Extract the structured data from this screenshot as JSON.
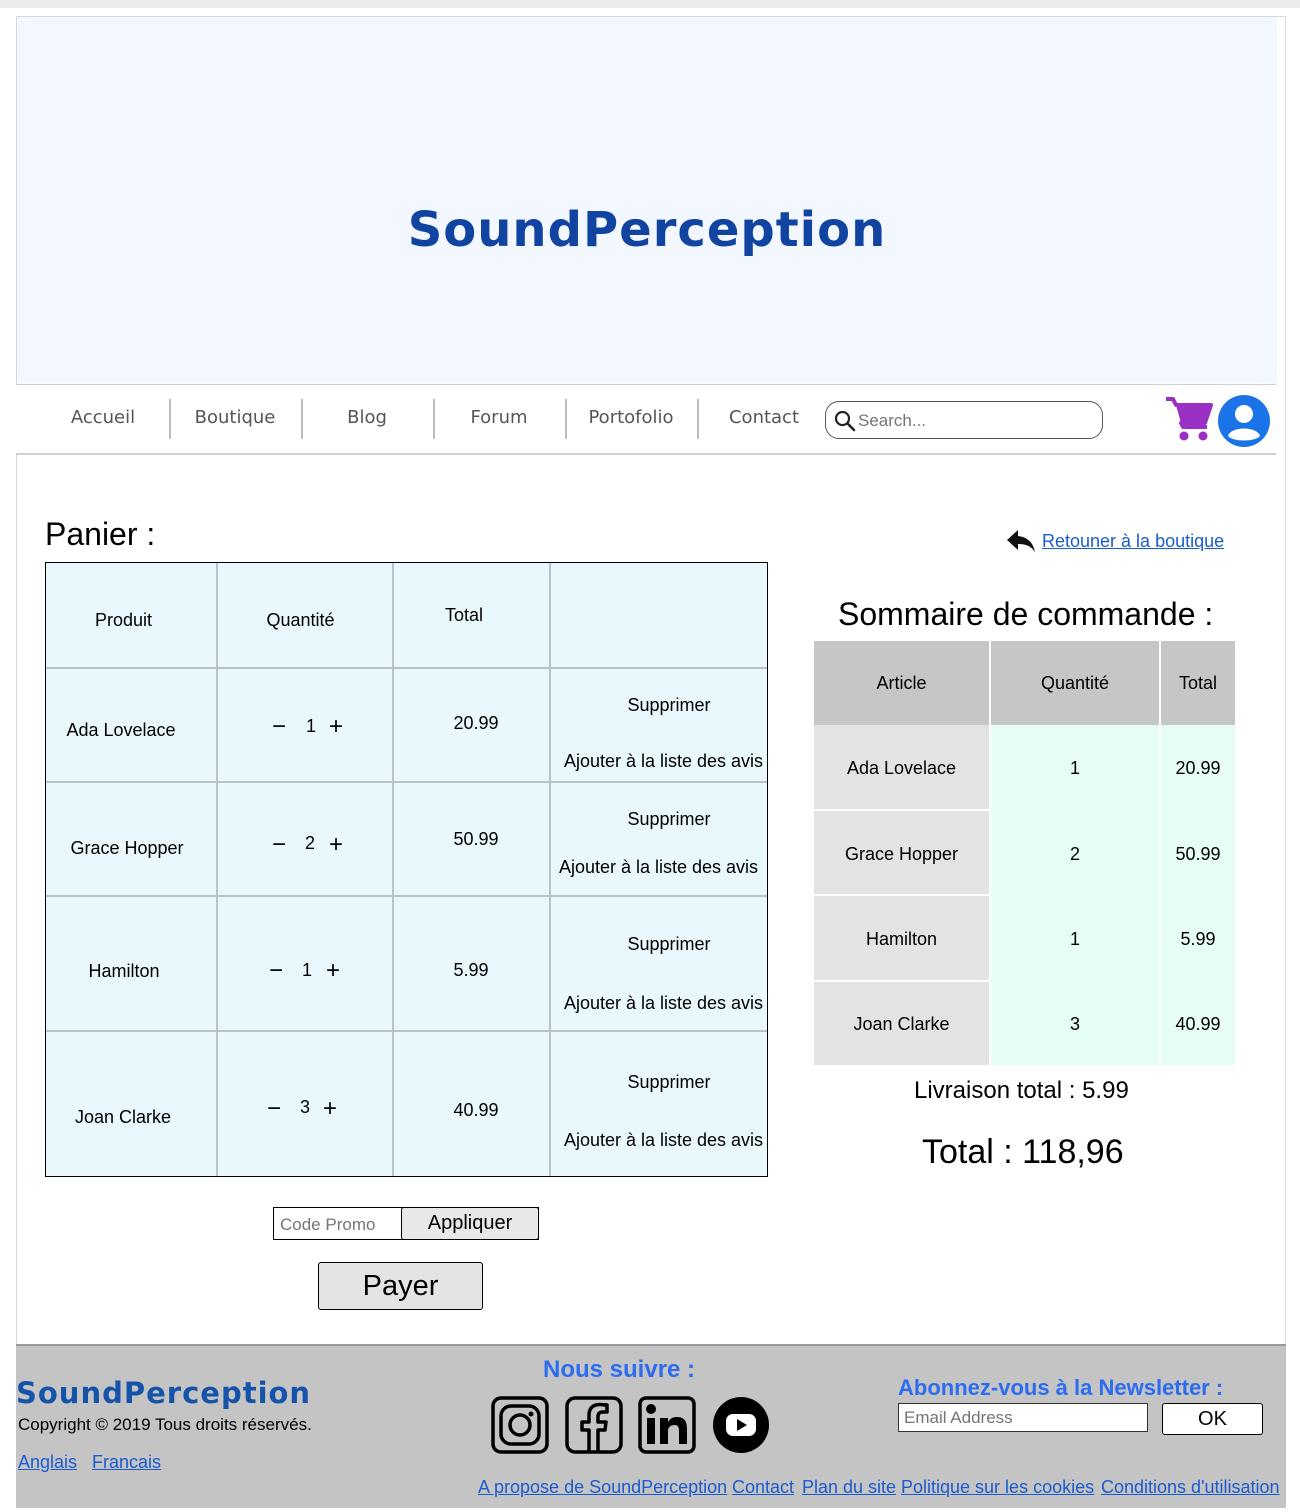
{
  "brand": "SoundPerception",
  "nav": {
    "items": [
      "Accueil",
      "Boutique",
      "Blog",
      "Forum",
      "Portofolio",
      "Contact"
    ],
    "search_placeholder": "Search..."
  },
  "cart": {
    "title": "Panier :",
    "back_link": "Retouner à la boutique",
    "headers": [
      "Produit",
      "Quantité",
      "Total",
      ""
    ],
    "rows": [
      {
        "product": "Ada Lovelace",
        "qty": "1",
        "total": "20.99",
        "remove": "Supprimer",
        "review": "Ajouter à la liste des avis"
      },
      {
        "product": "Grace Hopper",
        "qty": "2",
        "total": "50.99",
        "remove": "Supprimer",
        "review": "Ajouter à la liste des avis"
      },
      {
        "product": "Hamilton",
        "qty": "1",
        "total": "5.99",
        "remove": "Supprimer",
        "review": "Ajouter à la liste des avis"
      },
      {
        "product": "Joan Clarke",
        "qty": "3",
        "total": "40.99",
        "remove": "Supprimer",
        "review": "Ajouter à la liste des avis"
      }
    ],
    "minus": "−",
    "plus": "+"
  },
  "summary": {
    "title": "Sommaire de commande :",
    "headers": [
      "Article",
      "Quantité",
      "Total"
    ],
    "rows": [
      {
        "article": "Ada Lovelace",
        "qty": "1",
        "total": "20.99"
      },
      {
        "article": "Grace Hopper",
        "qty": "2",
        "total": "50.99"
      },
      {
        "article": "Hamilton",
        "qty": "1",
        "total": "5.99"
      },
      {
        "article": "Joan Clarke",
        "qty": "3",
        "total": "40.99"
      }
    ],
    "shipping": "Livraison total : 5.99",
    "total": "Total : 118,96"
  },
  "promo": {
    "placeholder": "Code Promo",
    "apply_label": "Appliquer"
  },
  "pay_label": "Payer",
  "footer": {
    "brand": "SoundPerception",
    "copyright": "Copyright © 2019 Tous droits réservés.",
    "languages": [
      "Anglais",
      "Francais"
    ],
    "follow_title": "Nous suivre :",
    "newsletter_title": "Abonnez-vous à la Newsletter :",
    "email_placeholder": "Email Address",
    "ok_label": "OK",
    "links": [
      "A propose de SoundPerception",
      "Contact",
      "Plan du site",
      "Politique sur les cookies",
      "Conditions d'utilisation"
    ]
  },
  "colors": {
    "brand": "#1144a0",
    "link": "#1a5bd0",
    "cart_icon": "#9a2fc4",
    "avatar": "#1a73e8"
  }
}
